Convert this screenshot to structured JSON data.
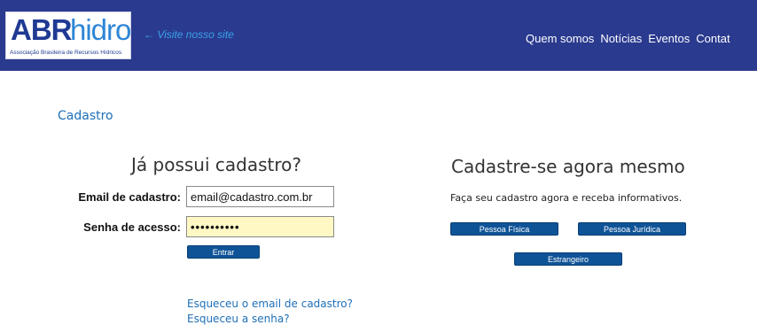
{
  "header": {
    "logo": {
      "abr": "ABR",
      "hidro": "hidro",
      "subtitle": "Associação Brasileira de Recursos Hídricos"
    },
    "visit_link": "← Visite nosso site",
    "nav": [
      "Quem somos",
      "Notícias",
      "Eventos",
      "Contat"
    ],
    "bg_color": "#2a3a8f"
  },
  "breadcrumb": "Cadastro",
  "login": {
    "heading": "Já possui cadastro?",
    "email_label": "Email de cadastro:",
    "email_value": "email@cadastro.com.br",
    "password_label": "Senha de acesso:",
    "password_value": "••••••••••",
    "submit_label": "Entrar",
    "forgot_email": "Esqueceu o email de cadastro?",
    "forgot_password": "Esqueceu a senha?"
  },
  "register": {
    "heading": "Cadastre-se agora mesmo",
    "description": "Faça seu cadastro agora e receba informativos.",
    "buttons": [
      "Pessoa Física",
      "Pessoa Jurídica",
      "Estrangeiro"
    ]
  }
}
